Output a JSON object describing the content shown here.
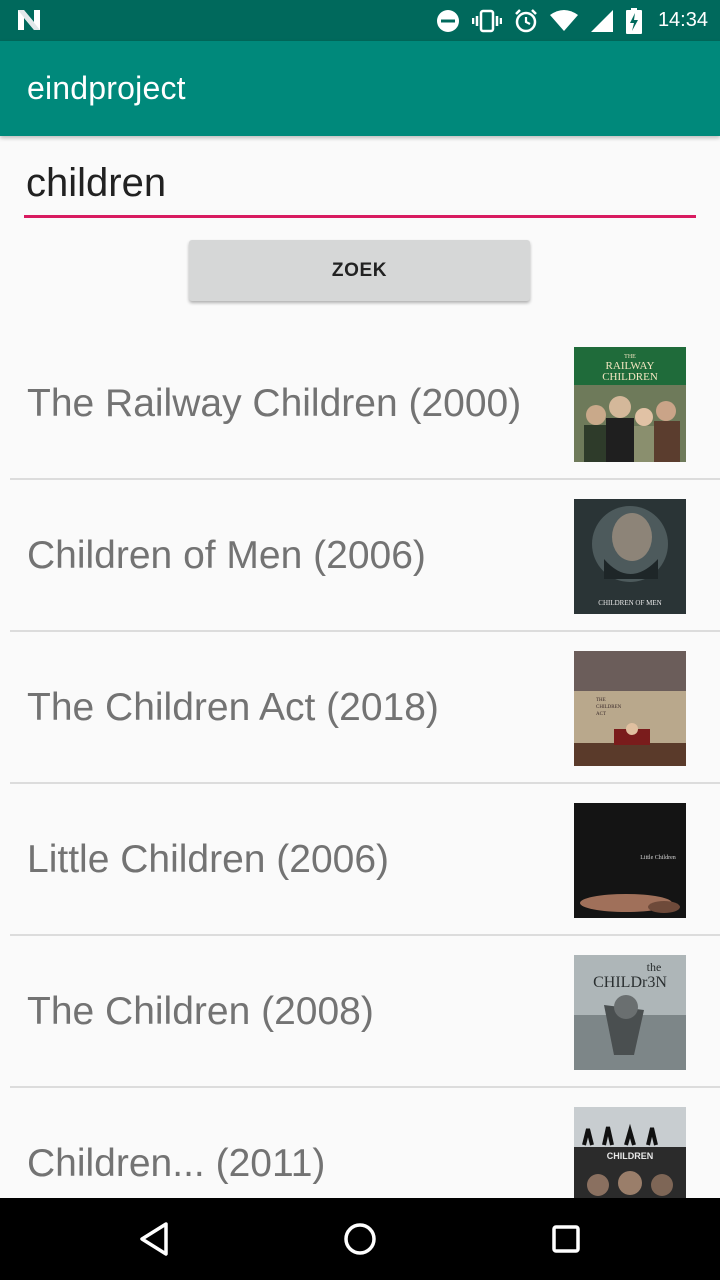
{
  "status_bar": {
    "time": "14:34",
    "icons": [
      "notification-n-icon",
      "do-not-disturb-icon",
      "vibrate-icon",
      "alarm-icon",
      "wifi-icon",
      "cell-signal-icon",
      "battery-charging-icon"
    ]
  },
  "app_bar": {
    "title": "eindproject"
  },
  "search": {
    "value": "children",
    "placeholder": ""
  },
  "search_button": {
    "label": "ZOEK"
  },
  "results": [
    {
      "title": "The Railway Children (2000)"
    },
    {
      "title": "Children of Men (2006)"
    },
    {
      "title": "The Children Act (2018)"
    },
    {
      "title": "Little Children (2006)"
    },
    {
      "title": "The Children (2008)"
    },
    {
      "title": "Children... (2011)"
    }
  ],
  "posters": {
    "railway": {
      "line1": "THE",
      "line2": "RAILWAY",
      "line3": "CHILDREN"
    },
    "men": {
      "text": "CHILDREN OF MEN"
    },
    "act": {
      "line1": "THE",
      "line2": "CHILDREN",
      "line3": "ACT"
    },
    "little": {
      "text": "Little Children"
    },
    "the_children": {
      "line1": "the",
      "line2": "CHILDr3N"
    },
    "children_2011": {
      "text": "CHILDREN"
    }
  },
  "nav_bar": {
    "icons": [
      "back-icon",
      "home-icon",
      "recents-icon"
    ]
  },
  "colors": {
    "status_bar": "#00695c",
    "app_bar": "#00897b",
    "accent": "#d81b60"
  }
}
